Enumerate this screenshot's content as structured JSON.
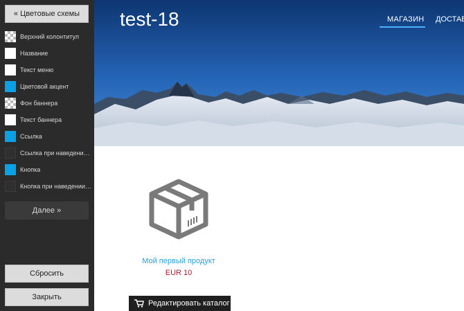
{
  "sidebar": {
    "back_button": "« Цветовые схемы",
    "items": [
      {
        "label": "Верхний колонтитул",
        "swatch": "checker"
      },
      {
        "label": "Название",
        "swatch": "white"
      },
      {
        "label": "Текст меню",
        "swatch": "white"
      },
      {
        "label": "Цветовой акцент",
        "swatch": "blue"
      },
      {
        "label": "Фон баннера",
        "swatch": "checker"
      },
      {
        "label": "Текст баннера",
        "swatch": "white"
      },
      {
        "label": "Ссылка",
        "swatch": "blue"
      },
      {
        "label": "Ссылка при наведении ...",
        "swatch": "dark"
      },
      {
        "label": "Кнопка",
        "swatch": "blue"
      },
      {
        "label": "Кнопка при наведении ...",
        "swatch": "dark"
      }
    ],
    "next_button": "Далее »",
    "reset_button": "Сбросить",
    "close_button": "Закрыть"
  },
  "header": {
    "site_title": "test-18",
    "nav": {
      "shop": "МАГАЗИН",
      "delivery": "ДОСТАВ"
    }
  },
  "product": {
    "name": "Мой первый продукт",
    "price": "EUR 10"
  },
  "edit_catalog_button": "Редактировать каталог",
  "colors": {
    "accent": "#0aa1e6",
    "link": "#2a9fd6",
    "price": "#a51d2d"
  }
}
